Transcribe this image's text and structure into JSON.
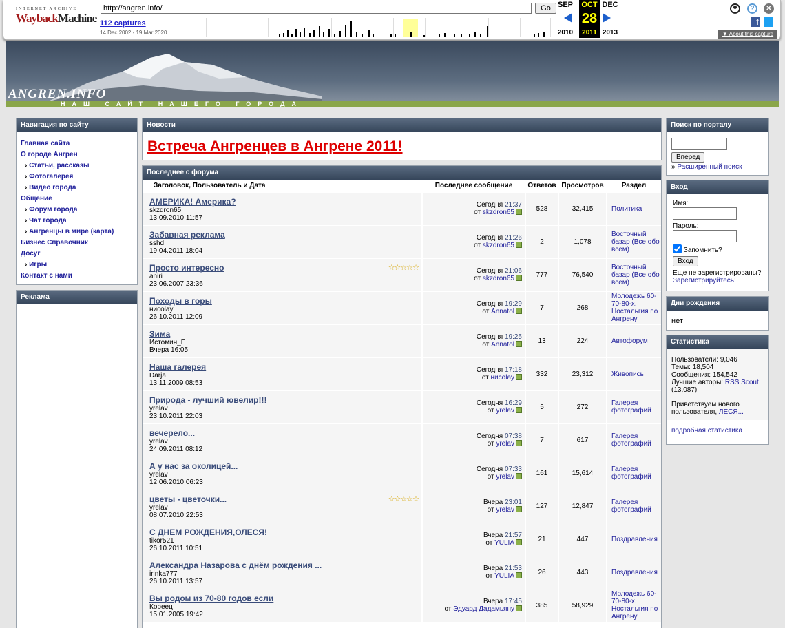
{
  "wayback": {
    "ia_label": "INTERNET ARCHIVE",
    "logo_way": "Wayback",
    "logo_machine": "Machine",
    "url": "http://angren.info/",
    "go": "Go",
    "captures": "112 captures",
    "range": "14 Dec 2002 - 19 Mar 2020",
    "prev_month": "SEP",
    "cur_month": "OCT",
    "next_month": "DEC",
    "day": "28",
    "prev_year": "2010",
    "cur_year": "2011",
    "next_year": "2013",
    "about": "▼ About this capture"
  },
  "header": {
    "site": "ANGREN.INFO",
    "slogan": "НАШ САЙТ НАШЕГО ГОРОДА"
  },
  "nav": {
    "title": "Навигация по сайту",
    "items": [
      {
        "label": "Главная сайта",
        "sub": false
      },
      {
        "label": "О городе Ангрен",
        "sub": false
      },
      {
        "label": "Статьи, рассказы",
        "sub": true
      },
      {
        "label": "Фотогалерея",
        "sub": true
      },
      {
        "label": "Видео города",
        "sub": true
      },
      {
        "label": "Общение",
        "sub": false
      },
      {
        "label": "Форум города",
        "sub": true
      },
      {
        "label": "Чат города",
        "sub": true
      },
      {
        "label": "Ангренцы в мире (карта)",
        "sub": true
      },
      {
        "label": "Бизнес Справочник",
        "sub": false
      },
      {
        "label": "Досуг",
        "sub": false
      },
      {
        "label": "Игры",
        "sub": true
      },
      {
        "label": "Контакт с нами",
        "sub": false
      }
    ]
  },
  "ads": {
    "title": "Реклама"
  },
  "news": {
    "title": "Новости",
    "headline": "Встреча Ангренцев в Ангрене 2011!"
  },
  "forum": {
    "title": "Последнее с форума",
    "cols": [
      "Заголовок, Пользователь и Дата",
      "Последнее сообщение",
      "Ответов",
      "Просмотров",
      "Раздел"
    ],
    "rows": [
      {
        "t": "АМЕРИКА! Америка?",
        "u": "skzdron65",
        "d": "13.09.2010 11:57",
        "lday": "Сегодня",
        "ltime": "21:37",
        "lby": "skzdron65",
        "r": "528",
        "v": "32,415",
        "s": "Политика",
        "stars": ""
      },
      {
        "t": "Забавная реклама",
        "u": "sshd",
        "d": "19.04.2011 18:04",
        "lday": "Сегодня",
        "ltime": "21:26",
        "lby": "skzdron65",
        "r": "2",
        "v": "1,078",
        "s": "Восточный базар (Все обо всём)",
        "stars": ""
      },
      {
        "t": "Просто интересно",
        "u": "aniri",
        "d": "23.06.2007 23:36",
        "lday": "Сегодня",
        "ltime": "21:06",
        "lby": "skzdron65",
        "r": "777",
        "v": "76,540",
        "s": "Восточный базар (Все обо всём)",
        "stars": "☆☆☆☆☆"
      },
      {
        "t": "Походы в горы",
        "u": "нисolay",
        "d": "26.10.2011 12:09",
        "lday": "Сегодня",
        "ltime": "19:29",
        "lby": "Annatol",
        "r": "7",
        "v": "268",
        "s": "Молодежь 60-70-80-х. Ностальгия по Ангрену",
        "stars": ""
      },
      {
        "t": "Зима",
        "u": "Истомин_Е",
        "d": "Вчера 16:05",
        "lday": "Сегодня",
        "ltime": "19:25",
        "lby": "Annatol",
        "r": "13",
        "v": "224",
        "s": "Автофорум",
        "stars": ""
      },
      {
        "t": "Наша галерея",
        "u": "Darja",
        "d": "13.11.2009 08:53",
        "lday": "Сегодня",
        "ltime": "17:18",
        "lby": "нисolay",
        "r": "332",
        "v": "23,312",
        "s": "Живопись",
        "stars": ""
      },
      {
        "t": "Природа - лучший ювелир!!!",
        "u": "yrelav",
        "d": "23.10.2011 22:03",
        "lday": "Сегодня",
        "ltime": "16:29",
        "lby": "yrelav",
        "r": "5",
        "v": "272",
        "s": "Галерея фотографий",
        "stars": ""
      },
      {
        "t": "вечерело...",
        "u": "yrelav",
        "d": "24.09.2011 08:12",
        "lday": "Сегодня",
        "ltime": "07:38",
        "lby": "yrelav",
        "r": "7",
        "v": "617",
        "s": "Галерея фотографий",
        "stars": ""
      },
      {
        "t": "А у нас за околицей...",
        "u": "yrelav",
        "d": "12.06.2010 06:23",
        "lday": "Сегодня",
        "ltime": "07:33",
        "lby": "yrelav",
        "r": "161",
        "v": "15,614",
        "s": "Галерея фотографий",
        "stars": ""
      },
      {
        "t": "цветы - цветочки...",
        "u": "yrelav",
        "d": "08.07.2010 22:53",
        "lday": "Вчера",
        "ltime": "23:01",
        "lby": "yrelav",
        "r": "127",
        "v": "12,847",
        "s": "Галерея фотографий",
        "stars": "☆☆☆☆☆"
      },
      {
        "t": "С ДНЕМ РОЖДЕНИЯ,ОЛЕСЯ!",
        "u": "tikor521",
        "d": "26.10.2011 10:51",
        "lday": "Вчера",
        "ltime": "21:57",
        "lby": "YULIA",
        "r": "21",
        "v": "447",
        "s": "Поздравления",
        "stars": ""
      },
      {
        "t": "Александра Назарова с днём рождения ...",
        "u": "irinka777",
        "d": "26.10.2011 13:57",
        "lday": "Вчера",
        "ltime": "21:53",
        "lby": "YULIA",
        "r": "26",
        "v": "443",
        "s": "Поздравления",
        "stars": ""
      },
      {
        "t": "Вы родом из 70-80 годов если",
        "u": "Кореец",
        "d": "15.01.2005 19:42",
        "lday": "Вчера",
        "ltime": "17:45",
        "lby": "Эдуард Дадамьяну",
        "r": "385",
        "v": "58,929",
        "s": "Молодежь 60-70-80-х. Ностальгия по Ангрену",
        "stars": ""
      }
    ]
  },
  "search": {
    "title": "Поиск по порталу",
    "button": "Вперед",
    "adv": "Расширенный поиск",
    "adv_prefix": "» "
  },
  "login": {
    "title": "Вход",
    "name_label": "Имя:",
    "pass_label": "Пароль:",
    "remember": "Запомнить?",
    "button": "Вход",
    "not_reg": "Еще не зарегистрированы?",
    "register": "Зарегистрируйтесь!"
  },
  "birthdays": {
    "title": "Дни рождения",
    "value": "нет"
  },
  "stats": {
    "title": "Статистика",
    "users": "Пользователи: 9,046",
    "topics": "Темы: 18,504",
    "posts": "Сообщения: 154,542",
    "best_prefix": "Лучшие авторы: ",
    "best_user": "RSS Scout",
    "best_count": "(13,087)",
    "welcome": "Приветствуем нового пользователя, ",
    "new_user": "ЛЕСЯ...",
    "more": "подробная статистика"
  },
  "colors": {
    "header_dark": "#3b4a5e",
    "headline": "#dd0000",
    "slogan_bar": "#8aa64a"
  }
}
